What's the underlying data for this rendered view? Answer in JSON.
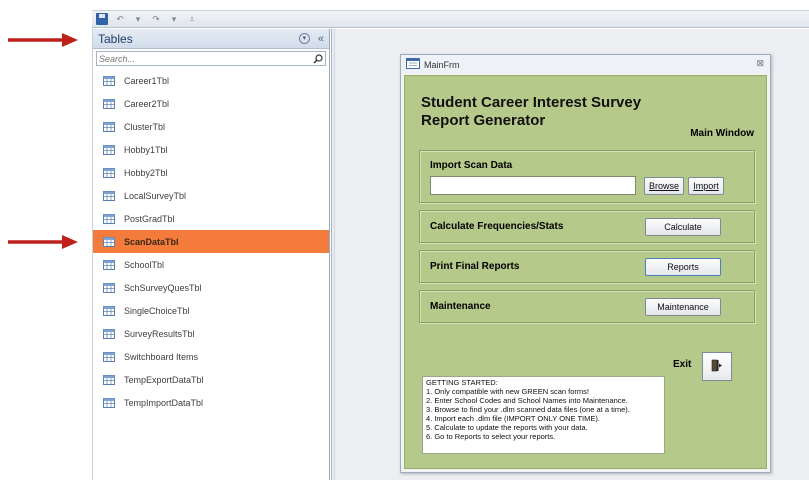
{
  "nav": {
    "title": "Tables",
    "search_placeholder": "Search...",
    "items": [
      {
        "label": "Career1Tbl"
      },
      {
        "label": "Career2Tbl"
      },
      {
        "label": "ClusterTbl"
      },
      {
        "label": "Hobby1Tbl"
      },
      {
        "label": "Hobby2Tbl"
      },
      {
        "label": "LocalSurveyTbl"
      },
      {
        "label": "PostGradTbl"
      },
      {
        "label": "ScanDataTbl"
      },
      {
        "label": "SchoolTbl"
      },
      {
        "label": "SchSurveyQuesTbl"
      },
      {
        "label": "SingleChoiceTbl"
      },
      {
        "label": "SurveyResultsTbl"
      },
      {
        "label": "Switchboard Items"
      },
      {
        "label": "TempExportDataTbl"
      },
      {
        "label": "TempImportDataTbl"
      }
    ],
    "selected_item": "ScanDataTbl",
    "selected_color": "#f47b3b"
  },
  "form": {
    "window_title": "MainFrm",
    "heading_line1": "Student Career Interest Survey",
    "heading_line2": "Report Generator",
    "main_window_label": "Main Window",
    "background_color": "#b5c98a",
    "import": {
      "label": "Import Scan Data",
      "file_value": "",
      "browse_label": "Browse",
      "import_label": "Import"
    },
    "calculate": {
      "label": "Calculate Frequencies/Stats",
      "button_label": "Calculate"
    },
    "reports": {
      "label": "Print Final Reports",
      "button_label": "Reports"
    },
    "maintenance": {
      "label": "Maintenance",
      "button_label": "Maintenance"
    },
    "exit_label": "Exit",
    "notes": [
      "GETTING STARTED:",
      "1.  Only compatible with new GREEN scan forms!",
      "2.  Enter School Codes and School Names into Maintenance.",
      "3.  Browse to find your .dlm scanned data files (one at a time).",
      "4.  Import each .dlm file (IMPORT ONLY ONE TIME).",
      "5.  Calculate to update the reports with your data.",
      "6.  Go to Reports to select your reports."
    ]
  },
  "annotations": {
    "arrow_color": "#c0201c"
  }
}
